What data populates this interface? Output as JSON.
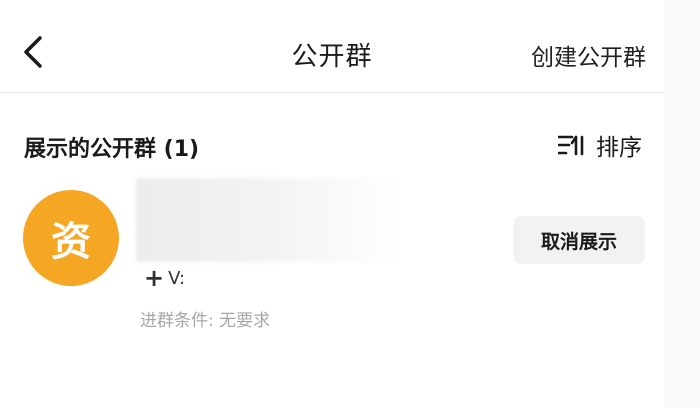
{
  "header": {
    "title": "公开群",
    "create_label": "创建公开群",
    "back_icon": "chevron-left-icon"
  },
  "section": {
    "title": "展示的公开群 (1)",
    "sort_label": "排序",
    "sort_icon": "sort-icon"
  },
  "groups": [
    {
      "avatar_char": "资",
      "avatar_color": "#f5a623",
      "contact_prefix": "+",
      "contact_text": "V:",
      "condition": "进群条件: 无要求",
      "action_label": "取消展示"
    }
  ],
  "colors": {
    "accent": "#f5a623",
    "muted_text": "#a8a8a8",
    "button_bg": "#f2f2f2"
  }
}
